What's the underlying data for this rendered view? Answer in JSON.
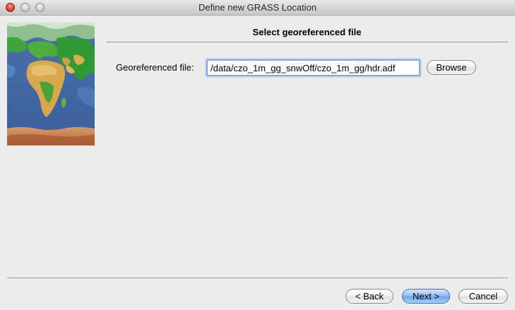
{
  "window": {
    "title": "Define new GRASS Location"
  },
  "page": {
    "heading": "Select georeferenced file"
  },
  "form": {
    "file_label": "Georeferenced file:",
    "file_value": "/data/czo_1m_gg_snwOff/czo_1m_gg/hdr.adf",
    "browse_label": "Browse"
  },
  "footer": {
    "back_label": "< Back",
    "next_label": "Next >",
    "cancel_label": "Cancel"
  },
  "colors": {
    "focus_ring": "#7fa9e2",
    "default_button": "#6aa5ea",
    "close_button": "#e0443a"
  },
  "icons": {
    "sidebar_image": "world-map-image"
  }
}
